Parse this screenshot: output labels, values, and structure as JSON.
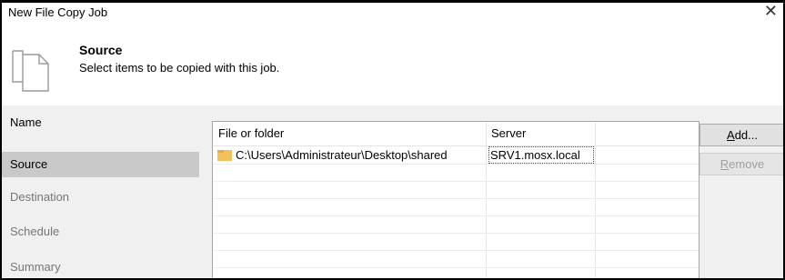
{
  "window": {
    "title": "New File Copy Job"
  },
  "header": {
    "title": "Source",
    "subtitle": "Select items to be copied with this job.",
    "icon": "document-icon"
  },
  "steps": [
    {
      "label": "Name",
      "state": "done"
    },
    {
      "label": "Source",
      "state": "active"
    },
    {
      "label": "Destination",
      "state": "pending"
    },
    {
      "label": "Schedule",
      "state": "pending"
    },
    {
      "label": "Summary",
      "state": "pending"
    }
  ],
  "table": {
    "columns": [
      "File or folder",
      "Server"
    ],
    "rows": [
      {
        "path": "C:\\Users\\Administrateur\\Desktop\\shared",
        "server": "SRV1.mosx.local",
        "icon": "folder-icon"
      }
    ]
  },
  "buttons": {
    "add": "Add...",
    "remove": "Remove"
  },
  "colors": {
    "active_step": "#c9c9c9",
    "sidebar": "#f0f0f0",
    "folder": "#f4c05a"
  }
}
